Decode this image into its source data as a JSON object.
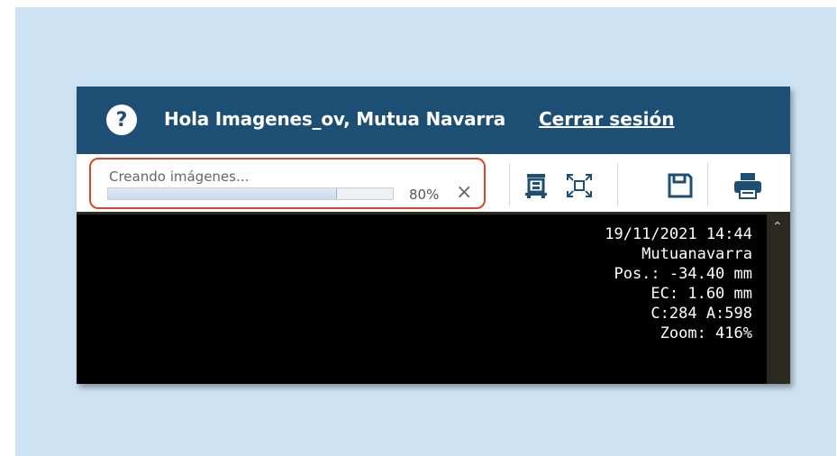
{
  "header": {
    "greeting": "Hola Imagenes_ov, Mutua Navarra",
    "logout_label": "Cerrar sesión",
    "help_icon": "question-circle-icon"
  },
  "progress": {
    "label": "Creando imágenes...",
    "percent_text": "80%",
    "value": 0.8,
    "cancel_label": "×"
  },
  "toolbar": {
    "tools": [
      "crop-image-icon",
      "fit-to-screen-icon",
      "save-icon",
      "print-icon"
    ]
  },
  "viewer": {
    "overlay": {
      "datetime": "19/11/2021 14:44",
      "institution": "Mutuanavarra",
      "position": "Pos.: -34.40 mm",
      "thickness": "EC: 1.60 mm",
      "window": "C:284 A:598",
      "zoom": "Zoom: 416%"
    }
  },
  "colors": {
    "header_bg": "#1d4f75",
    "highlight": "#d9462e",
    "backdrop": "#cde2f3",
    "toolbar_icon": "#1d4f75"
  }
}
